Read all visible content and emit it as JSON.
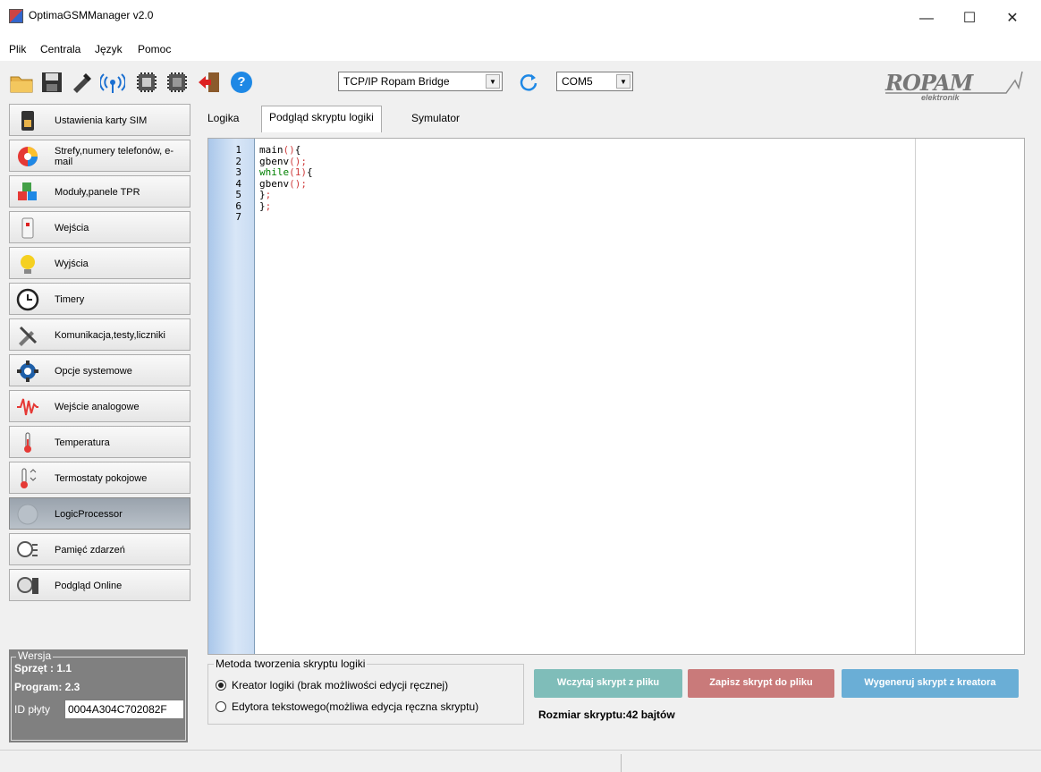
{
  "window": {
    "title": "OptimaGSMManager v2.0",
    "minimize": "—",
    "maximize": "☐",
    "close": "✕"
  },
  "menu": [
    "Plik",
    "Centrala",
    "Język",
    "Pomoc"
  ],
  "toolbar": {
    "connection_select": "TCP/IP Ropam Bridge",
    "port_select": "COM5",
    "help_glyph": "?",
    "logo_text": "ROPAM",
    "logo_sub": "elektronik"
  },
  "sidebar": {
    "items": [
      {
        "label": "Ustawienia karty SIM",
        "icon": "sim-card-icon"
      },
      {
        "label": "Strefy,numery telefonów, e-mail",
        "icon": "zones-pie-icon"
      },
      {
        "label": "Moduły,panele TPR",
        "icon": "modules-cubes-icon"
      },
      {
        "label": "Wejścia",
        "icon": "sensor-icon"
      },
      {
        "label": "Wyjścia",
        "icon": "bulb-icon"
      },
      {
        "label": "Timery",
        "icon": "clock-icon"
      },
      {
        "label": "Komunikacja,testy,liczniki",
        "icon": "tools-icon"
      },
      {
        "label": "Opcje systemowe",
        "icon": "gear-icon"
      },
      {
        "label": "Wejście analogowe",
        "icon": "wave-icon"
      },
      {
        "label": "Temperatura",
        "icon": "thermometer-icon"
      },
      {
        "label": "Termostaty pokojowe",
        "icon": "thermostat-icon"
      },
      {
        "label": "LogicProcessor",
        "icon": "logic-icon",
        "active": true
      },
      {
        "label": "Pamięć zdarzeń",
        "icon": "event-log-icon"
      },
      {
        "label": "Podgląd Online",
        "icon": "online-preview-icon"
      }
    ]
  },
  "version": {
    "title": "Wersja",
    "hardware": "Sprzęt : 1.1",
    "program": "Program: 2.3",
    "id_label": "ID płyty",
    "id_value": "0004A304C702082F"
  },
  "tabs": [
    "Logika",
    "Podgląd skryptu logiki",
    "Symulator"
  ],
  "editor": {
    "line_numbers": [
      "1",
      "2",
      "3",
      "4",
      "5",
      "6",
      "7"
    ],
    "lines": [
      [
        {
          "t": "main",
          "c": "fn"
        },
        {
          "t": "()",
          "c": "p"
        },
        {
          "t": "{",
          "c": "fn"
        }
      ],
      [
        {
          "t": "gbenv",
          "c": "fn"
        },
        {
          "t": "();",
          "c": "p"
        }
      ],
      [
        {
          "t": "while",
          "c": "kw"
        },
        {
          "t": "(1)",
          "c": "p"
        },
        {
          "t": "{",
          "c": "fn"
        }
      ],
      [
        {
          "t": "gbenv",
          "c": "fn"
        },
        {
          "t": "();",
          "c": "p"
        }
      ],
      [
        {
          "t": "}",
          "c": "fn"
        },
        {
          "t": ";",
          "c": "p"
        }
      ],
      [
        {
          "t": "}",
          "c": "fn"
        },
        {
          "t": ";",
          "c": "p"
        }
      ],
      []
    ]
  },
  "method": {
    "title": "Metoda tworzenia skryptu logiki",
    "options": [
      {
        "label": "Kreator logiki (brak możliwości edycji ręcznej)",
        "selected": true
      },
      {
        "label": "Edytora tekstowego(możliwa edycja ręczna skryptu)",
        "selected": false
      }
    ]
  },
  "buttons": {
    "load": "Wczytaj skrypt z pliku",
    "save": "Zapisz skrypt do pliku",
    "generate": "Wygeneruj skrypt z kreatora"
  },
  "script_size": "Rozmiar skryptu:42 bajtów",
  "colors": {
    "load": "#7fbdb9",
    "save": "#c97a7a",
    "generate": "#6aaed6"
  }
}
